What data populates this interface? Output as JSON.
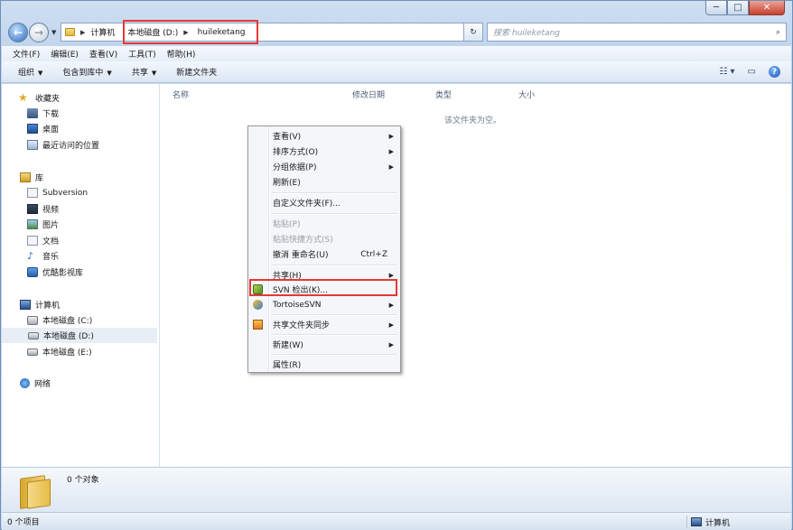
{
  "window": {
    "caption": {
      "minimize": "─",
      "maximize": "□",
      "close": "✕"
    }
  },
  "nav": {
    "back": "←",
    "forward": "→",
    "address": {
      "crumbs": [
        "计算机",
        "本地磁盘 (D:)",
        "huileketang"
      ]
    },
    "refresh": "↻",
    "search_placeholder": "搜索 huileketang"
  },
  "menubar": [
    "文件(F)",
    "编辑(E)",
    "查看(V)",
    "工具(T)",
    "帮助(H)"
  ],
  "commandbar": {
    "items": [
      {
        "label": "组织",
        "dropdown": true
      },
      {
        "label": "包含到库中",
        "dropdown": true
      },
      {
        "label": "共享",
        "dropdown": true
      },
      {
        "label": "新建文件夹",
        "dropdown": false
      }
    ],
    "help": "?"
  },
  "navpane": {
    "items": [
      {
        "label": "收藏夹",
        "icon": "star-icon"
      },
      {
        "label": "下载",
        "icon": "download-folder-icon"
      },
      {
        "label": "桌面",
        "icon": "desktop-icon"
      },
      {
        "label": "最近访问的位置",
        "icon": "recent-places-icon"
      },
      {
        "label": "库",
        "icon": "library-icon"
      },
      {
        "label": "Subversion",
        "icon": "document-library-icon"
      },
      {
        "label": "视频",
        "icon": "video-icon"
      },
      {
        "label": "图片",
        "icon": "picture-icon"
      },
      {
        "label": "文档",
        "icon": "document-icon"
      },
      {
        "label": "音乐",
        "icon": "music-icon"
      },
      {
        "label": "优酷影视库",
        "icon": "youku-library-icon"
      },
      {
        "label": "计算机",
        "icon": "computer-icon"
      },
      {
        "label": "本地磁盘 (C:)",
        "icon": "drive-c-icon"
      },
      {
        "label": "本地磁盘 (D:)",
        "icon": "drive-d-icon",
        "selected": true
      },
      {
        "label": "本地磁盘 (E:)",
        "icon": "drive-e-icon"
      },
      {
        "label": "网络",
        "icon": "network-icon"
      }
    ]
  },
  "content": {
    "columns": [
      "名称",
      "修改日期",
      "类型",
      "大小"
    ],
    "empty_text": "该文件夹为空。"
  },
  "context_menu": {
    "items": [
      {
        "label": "查看(V)",
        "submenu": true
      },
      {
        "label": "排序方式(O)",
        "submenu": true
      },
      {
        "label": "分组依据(P)",
        "submenu": true
      },
      {
        "label": "刷新(E)"
      },
      {
        "label": "自定义文件夹(F)..."
      },
      {
        "label": "粘贴(P)",
        "disabled": true
      },
      {
        "label": "粘贴快捷方式(S)",
        "disabled": true
      },
      {
        "label": "撤消 重命名(U)",
        "shortcut": "Ctrl+Z"
      },
      {
        "label": "共享(H)",
        "submenu": true
      },
      {
        "label": "SVN 检出(K)...",
        "icon": "svn-checkout-icon",
        "highlighted": true
      },
      {
        "label": "TortoiseSVN",
        "icon": "tortoisesvn-icon",
        "submenu": true
      },
      {
        "label": "共享文件夹同步",
        "icon": "sync-icon",
        "submenu": true
      },
      {
        "label": "新建(W)",
        "submenu": true
      },
      {
        "label": "属性(R)"
      }
    ]
  },
  "details": {
    "object_count": "0 个对象"
  },
  "status": {
    "left": "0 个项目",
    "right": "计算机"
  },
  "colors": {
    "annotation_red": "#e53935"
  }
}
